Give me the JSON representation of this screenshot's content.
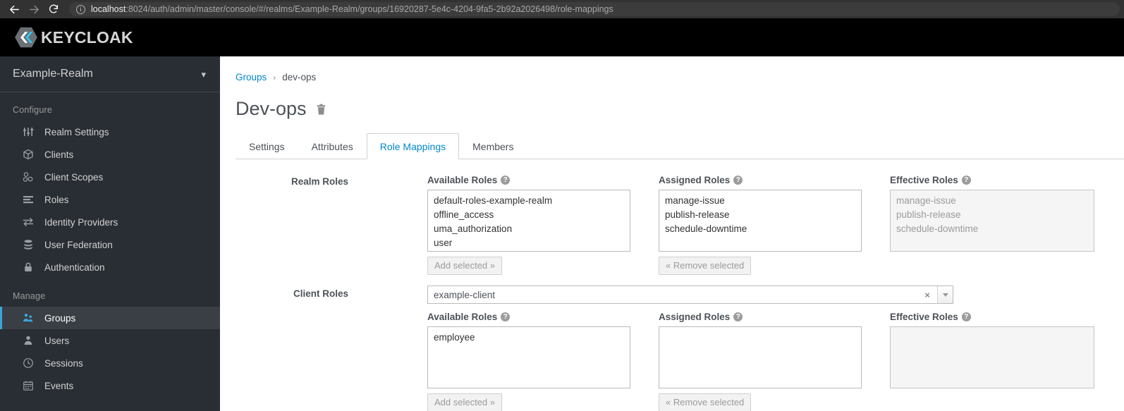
{
  "browser": {
    "back_icon": "back-arrow-icon",
    "forward_icon": "forward-arrow-icon",
    "reload_icon": "reload-icon",
    "site_info_icon": "info-icon",
    "url_host": "localhost",
    "url_path": ":8024/auth/admin/master/console/#/realms/Example-Realm/groups/16920287-5e4c-4204-9fa5-2b92a2026498/role-mappings"
  },
  "brand": {
    "name": "KEYCLOAK",
    "logo_icon": "keycloak-logo-icon",
    "accent_color": "#39a5dc",
    "link_color": "#0088ce"
  },
  "sidebar": {
    "realm_name": "Example-Realm",
    "realm_chevron_icon": "chevron-down-icon",
    "groups": [
      {
        "title": "Configure",
        "items": [
          {
            "label": "Realm Settings",
            "icon": "sliders-icon",
            "active": false
          },
          {
            "label": "Clients",
            "icon": "cube-icon",
            "active": false
          },
          {
            "label": "Client Scopes",
            "icon": "cubes-icon",
            "active": false
          },
          {
            "label": "Roles",
            "icon": "list-icon",
            "active": false
          },
          {
            "label": "Identity Providers",
            "icon": "exchange-arrows-icon",
            "active": false
          },
          {
            "label": "User Federation",
            "icon": "database-icon",
            "active": false
          },
          {
            "label": "Authentication",
            "icon": "lock-icon",
            "active": false
          }
        ]
      },
      {
        "title": "Manage",
        "items": [
          {
            "label": "Groups",
            "icon": "users-group-icon",
            "active": true
          },
          {
            "label": "Users",
            "icon": "user-icon",
            "active": false
          },
          {
            "label": "Sessions",
            "icon": "clock-icon",
            "active": false
          },
          {
            "label": "Events",
            "icon": "calendar-icon",
            "active": false
          }
        ]
      }
    ]
  },
  "main": {
    "breadcrumb": {
      "parent": "Groups",
      "separator": "›",
      "current": "dev-ops"
    },
    "title": "Dev-ops",
    "delete_icon": "trash-icon",
    "tabs": [
      {
        "label": "Settings",
        "active": false
      },
      {
        "label": "Attributes",
        "active": false
      },
      {
        "label": "Role Mappings",
        "active": true
      },
      {
        "label": "Members",
        "active": false
      }
    ],
    "help_icon": "question-circle-icon",
    "realm_roles": {
      "row_label": "Realm Roles",
      "available": {
        "header": "Available Roles",
        "options": [
          "default-roles-example-realm",
          "offline_access",
          "uma_authorization",
          "user"
        ],
        "button": "Add selected »"
      },
      "assigned": {
        "header": "Assigned Roles",
        "options": [
          "manage-issue",
          "publish-release",
          "schedule-downtime"
        ],
        "button": "« Remove selected"
      },
      "effective": {
        "header": "Effective Roles",
        "options": [
          "manage-issue",
          "publish-release",
          "schedule-downtime"
        ]
      }
    },
    "client_roles": {
      "row_label": "Client Roles",
      "selected_client": "example-client",
      "clear_icon": "clear-x-icon",
      "clear_glyph": "×",
      "dropdown_icon": "caret-down-icon",
      "available": {
        "header": "Available Roles",
        "options": [
          "employee"
        ],
        "button": "Add selected »"
      },
      "assigned": {
        "header": "Assigned Roles",
        "options": [],
        "button": "« Remove selected"
      },
      "effective": {
        "header": "Effective Roles",
        "options": []
      }
    }
  }
}
